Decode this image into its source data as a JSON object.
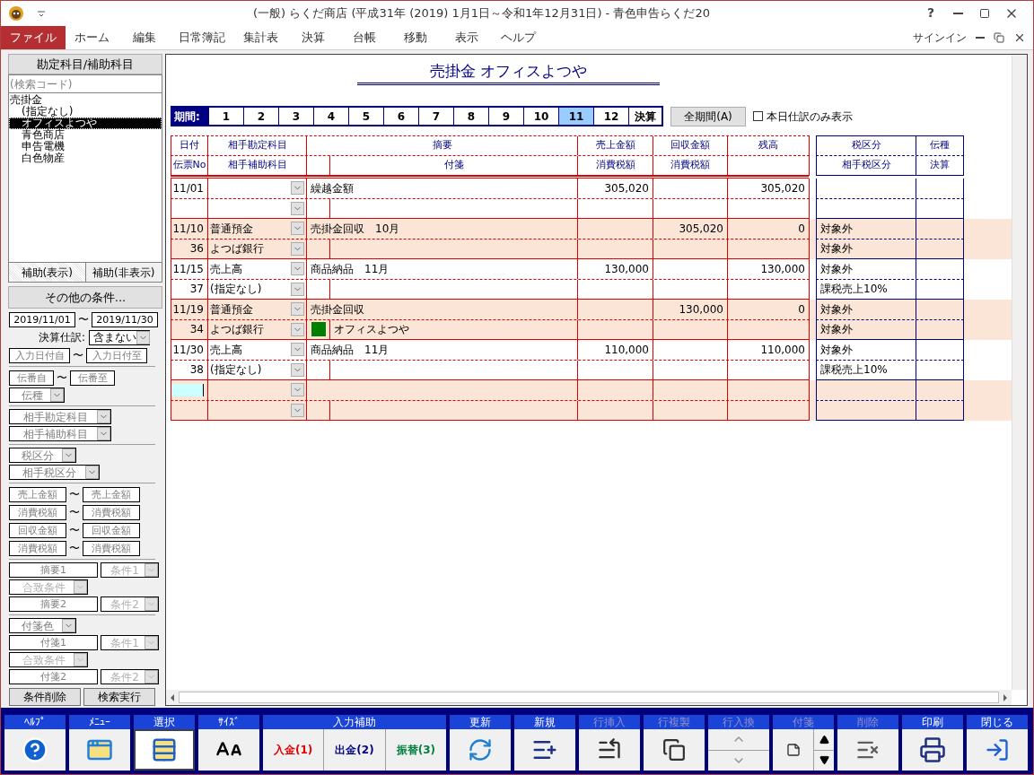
{
  "window": {
    "title": "(一般) らくだ商店 (平成31年 (2019) 1月1日～令和1年12月31日) - 青色申告らくだ20",
    "help": "?",
    "signin": "サインイン"
  },
  "menu": [
    {
      "label": "ファイル",
      "selected": true
    },
    {
      "label": "ホーム",
      "selected": false
    },
    {
      "label": "編集",
      "selected": false
    },
    {
      "label": "日常簿記",
      "selected": false
    },
    {
      "label": "集計表",
      "selected": false
    },
    {
      "label": "決算",
      "selected": false
    },
    {
      "label": "台帳",
      "selected": false
    },
    {
      "label": "移動",
      "selected": false
    },
    {
      "label": "表示",
      "selected": false
    },
    {
      "label": "ヘルプ",
      "selected": false
    }
  ],
  "sidebar": {
    "header": "勘定科目/補助科目",
    "search": {
      "placeholder": "(検索コード)"
    },
    "tree": [
      {
        "label": "売掛金",
        "selected": false,
        "children": [
          {
            "label": "(指定なし)",
            "selected": false
          },
          {
            "label": "オフィスよつや",
            "selected": true
          },
          {
            "label": "青色商店",
            "selected": false
          },
          {
            "label": "申告電機",
            "selected": false
          },
          {
            "label": "白色物産",
            "selected": false
          }
        ]
      }
    ],
    "tabs": [
      {
        "label": "補助(表示)",
        "selected": true
      },
      {
        "label": "補助(非表示)",
        "selected": false
      }
    ],
    "more_button": "その他の条件...",
    "filter_groups": [
      [
        {
          "kind": "range",
          "from": {
            "value": "2019/11/01"
          },
          "separator": "〜",
          "to": {
            "value": "2019/11/30"
          }
        },
        {
          "kind": "labeled",
          "label": "決算仕訳:",
          "select": {
            "value": "含まない",
            "disabled": false
          }
        },
        {
          "kind": "range",
          "from": {
            "placeholder": "入力日付自"
          },
          "separator": "〜",
          "to": {
            "placeholder": "入力日付至"
          }
        }
      ],
      [
        {
          "kind": "range",
          "from": {
            "placeholder": "伝番自"
          },
          "separator": "〜",
          "to": {
            "placeholder": "伝番至"
          }
        },
        {
          "kind": "select",
          "select": {
            "placeholder": "伝種",
            "disabled": false
          }
        }
      ],
      [
        {
          "kind": "select",
          "select": {
            "placeholder": "相手勘定科目",
            "disabled": false
          }
        },
        {
          "kind": "select",
          "select": {
            "placeholder": "相手補助科目",
            "disabled": false
          }
        }
      ],
      [
        {
          "kind": "select",
          "select": {
            "placeholder": "税区分",
            "disabled": false
          }
        },
        {
          "kind": "select",
          "select": {
            "placeholder": "相手税区分",
            "disabled": false
          }
        }
      ],
      [
        {
          "kind": "range",
          "from": {
            "placeholder": "売上金額"
          },
          "separator": "〜",
          "to": {
            "placeholder": "売上金額"
          }
        },
        {
          "kind": "range",
          "from": {
            "placeholder": "消費税額"
          },
          "separator": "〜",
          "to": {
            "placeholder": "消費税額"
          }
        },
        {
          "kind": "range",
          "from": {
            "placeholder": "回収金額"
          },
          "separator": "〜",
          "to": {
            "placeholder": "回収金額"
          }
        },
        {
          "kind": "range",
          "from": {
            "placeholder": "消費税額"
          },
          "separator": "〜",
          "to": {
            "placeholder": "消費税額"
          }
        }
      ],
      [
        {
          "kind": "condition",
          "field": {
            "placeholder": "摘要1"
          },
          "select": {
            "placeholder": "条件1",
            "disabled": true
          }
        },
        {
          "kind": "select",
          "select": {
            "placeholder": "合致条件",
            "disabled": true
          }
        },
        {
          "kind": "condition",
          "field": {
            "placeholder": "摘要2"
          },
          "select": {
            "placeholder": "条件2",
            "disabled": true
          }
        }
      ],
      [
        {
          "kind": "select",
          "select": {
            "placeholder": "付箋色",
            "disabled": false
          }
        },
        {
          "kind": "condition",
          "field": {
            "placeholder": "付箋1"
          },
          "select": {
            "placeholder": "条件1",
            "disabled": true
          }
        },
        {
          "kind": "select",
          "select": {
            "placeholder": "合致条件",
            "disabled": true
          }
        },
        {
          "kind": "condition",
          "field": {
            "placeholder": "付箋2"
          },
          "select": {
            "placeholder": "条件2",
            "disabled": true
          }
        }
      ]
    ],
    "actions": [
      "条件削除",
      "検索実行"
    ]
  },
  "ledger": {
    "title": "売掛金 オフィスよつや",
    "period_label": "期間:",
    "periods": [
      {
        "label": "1",
        "selected": false
      },
      {
        "label": "2",
        "selected": false
      },
      {
        "label": "3",
        "selected": false
      },
      {
        "label": "4",
        "selected": false
      },
      {
        "label": "5",
        "selected": false
      },
      {
        "label": "6",
        "selected": false
      },
      {
        "label": "7",
        "selected": false
      },
      {
        "label": "8",
        "selected": false
      },
      {
        "label": "9",
        "selected": false
      },
      {
        "label": "10",
        "selected": false
      },
      {
        "label": "11",
        "selected": true
      },
      {
        "label": "12",
        "selected": false
      },
      {
        "label": "決算",
        "selected": false
      }
    ],
    "all_periods": "全期間(A)",
    "today_only": {
      "label": "本日仕訳のみ表示",
      "checked": false
    },
    "header": {
      "date": "日付",
      "account": "相手勘定科目",
      "summary": "摘要",
      "sales": "売上金額",
      "collected": "回収金額",
      "balance": "残高",
      "tax": "税区分",
      "slip_type": "伝種",
      "slip_no": "伝票No",
      "sub_account": "相手補助科目",
      "memo": "付箋",
      "sales_tax": "消費税額",
      "collected_tax": "消費税額",
      "partner_tax": "相手税区分",
      "settle": "決算"
    },
    "entries": [
      {
        "kind": "entry",
        "date": "11/01",
        "summary": "繰越金額",
        "sales": "305,020",
        "balance": "305,020"
      },
      {
        "kind": "entry",
        "date": "11/10",
        "account": "普通預金",
        "summary": "売掛金回収　10月",
        "collected": "305,020",
        "balance": "0",
        "tax": "対象外",
        "slip_no": "36",
        "sub_account": "よつば銀行",
        "partner_tax": "対象外"
      },
      {
        "kind": "entry",
        "date": "11/15",
        "account": "売上高",
        "summary": "商品納品　11月",
        "sales": "130,000",
        "balance": "130,000",
        "tax": "対象外",
        "slip_no": "37",
        "sub_account": "(指定なし)",
        "partner_tax": "課税売上10%"
      },
      {
        "kind": "entry",
        "date": "11/19",
        "account": "普通預金",
        "summary": "売掛金回収",
        "collected": "130,000",
        "balance": "0",
        "tax": "対象外",
        "slip_no": "34",
        "sub_account": "よつば銀行",
        "memo": {
          "text": "オフィスよつや",
          "color": "#008000"
        },
        "partner_tax": "対象外"
      },
      {
        "kind": "entry",
        "date": "11/30",
        "account": "売上高",
        "summary": "商品納品　11月",
        "sales": "110,000",
        "balance": "110,000",
        "tax": "対象外",
        "slip_no": "38",
        "sub_account": "(指定なし)",
        "partner_tax": "課税売上10%"
      },
      {
        "kind": "new"
      }
    ]
  },
  "toolbar": [
    {
      "label": "ﾍﾙﾌﾟ",
      "kind": "help",
      "disabled": false,
      "selected": false
    },
    {
      "label": "ﾒﾆｭｰ",
      "kind": "menu",
      "disabled": false,
      "selected": false
    },
    {
      "label": "選択",
      "kind": "select",
      "disabled": false,
      "selected": true
    },
    {
      "label": "ｻｲｽﾞ",
      "kind": "size",
      "disabled": false,
      "selected": false
    },
    {
      "label": "入力補助",
      "kind": "assist",
      "disabled": false,
      "selected": false,
      "buttons": [
        {
          "text": "入金(1)",
          "color": "#e00000"
        },
        {
          "text": "出金(2)",
          "color": "#000080"
        },
        {
          "text": "振替(3)",
          "color": "#008040"
        }
      ]
    },
    {
      "label": "更新",
      "kind": "refresh",
      "disabled": false,
      "selected": false
    },
    {
      "label": "新規",
      "kind": "new",
      "disabled": false,
      "selected": false
    },
    {
      "label": "行挿入",
      "kind": "insert",
      "disabled": true,
      "selected": false
    },
    {
      "label": "行複製",
      "kind": "copy",
      "disabled": true,
      "selected": false
    },
    {
      "label": "行入換",
      "kind": "swap",
      "disabled": true,
      "selected": false
    },
    {
      "label": "付箋",
      "kind": "sticky",
      "disabled": true,
      "selected": false
    },
    {
      "label": "削除",
      "kind": "delete",
      "disabled": true,
      "selected": false
    },
    {
      "label": "印刷",
      "kind": "print",
      "disabled": false,
      "selected": false
    },
    {
      "label": "閉じる",
      "kind": "close",
      "disabled": false,
      "selected": false
    }
  ]
}
